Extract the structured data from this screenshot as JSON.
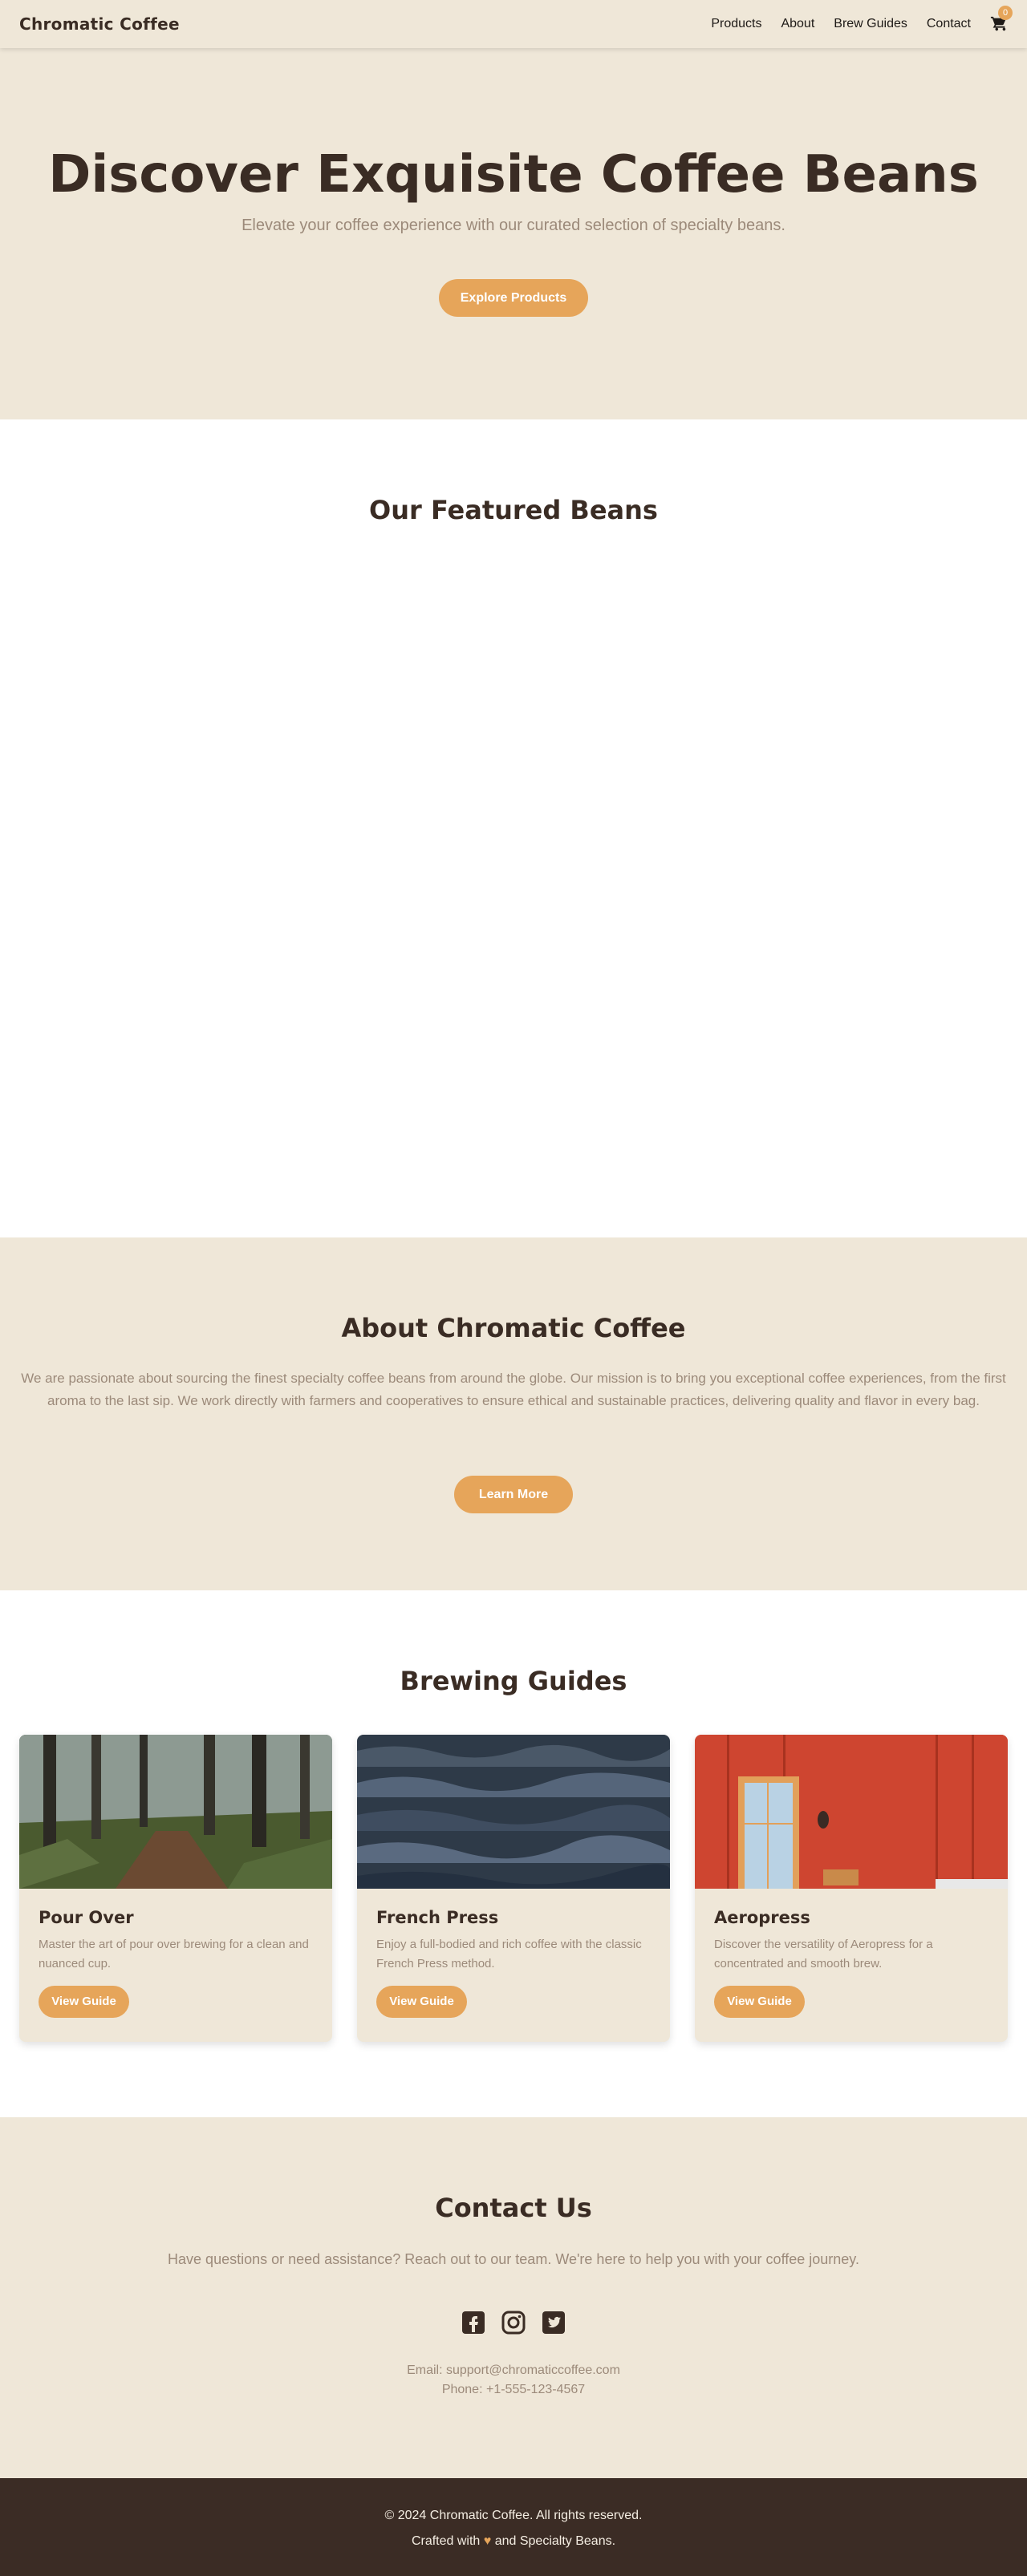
{
  "header": {
    "brand": "Chromatic Coffee",
    "nav": [
      "Products",
      "About",
      "Brew Guides",
      "Contact"
    ],
    "cart_count": "0"
  },
  "hero": {
    "title": "Discover Exquisite Coffee Beans",
    "subtitle": "Elevate your coffee experience with our curated selection of specialty beans.",
    "button": "Explore Products"
  },
  "featured": {
    "title": "Our Featured Beans"
  },
  "about": {
    "title": "About Chromatic Coffee",
    "text": "We are passionate about sourcing the finest specialty coffee beans from around the globe. Our mission is to bring you exceptional coffee experiences, from the first aroma to the last sip. We work directly with farmers and cooperatives to ensure ethical and sustainable practices, delivering quality and flavor in every bag.",
    "button": "Learn More"
  },
  "guides": {
    "title": "Brewing Guides",
    "items": [
      {
        "title": "Pour Over",
        "desc": "Master the art of pour over brewing for a clean and nuanced cup.",
        "button": "View Guide",
        "image": "forest-path-photo"
      },
      {
        "title": "French Press",
        "desc": "Enjoy a full-bodied and rich coffee with the classic French Press method.",
        "button": "View Guide",
        "image": "ocean-waves-photo"
      },
      {
        "title": "Aeropress",
        "desc": "Discover the versatility of Aeropress for a concentrated and smooth brew.",
        "button": "View Guide",
        "image": "red-wall-door-photo"
      }
    ]
  },
  "contact": {
    "title": "Contact Us",
    "text": "Have questions or need assistance? Reach out to our team. We're here to help you with your coffee journey.",
    "social": [
      "facebook-icon",
      "instagram-icon",
      "twitter-icon"
    ],
    "email": "Email: support@chromaticcoffee.com",
    "phone": "Phone: +1-555-123-4567"
  },
  "footer": {
    "copyright": "© 2024 Chromatic Coffee. All rights reserved.",
    "crafted_prefix": "Crafted with",
    "heart": "♥",
    "crafted_suffix": "and Specialty Beans."
  },
  "colors": {
    "cream": "#efe7d8",
    "accent": "#e6a55a",
    "dark": "#3a2c24",
    "muted": "#9c8a7a",
    "footer": "#3b2c25"
  }
}
